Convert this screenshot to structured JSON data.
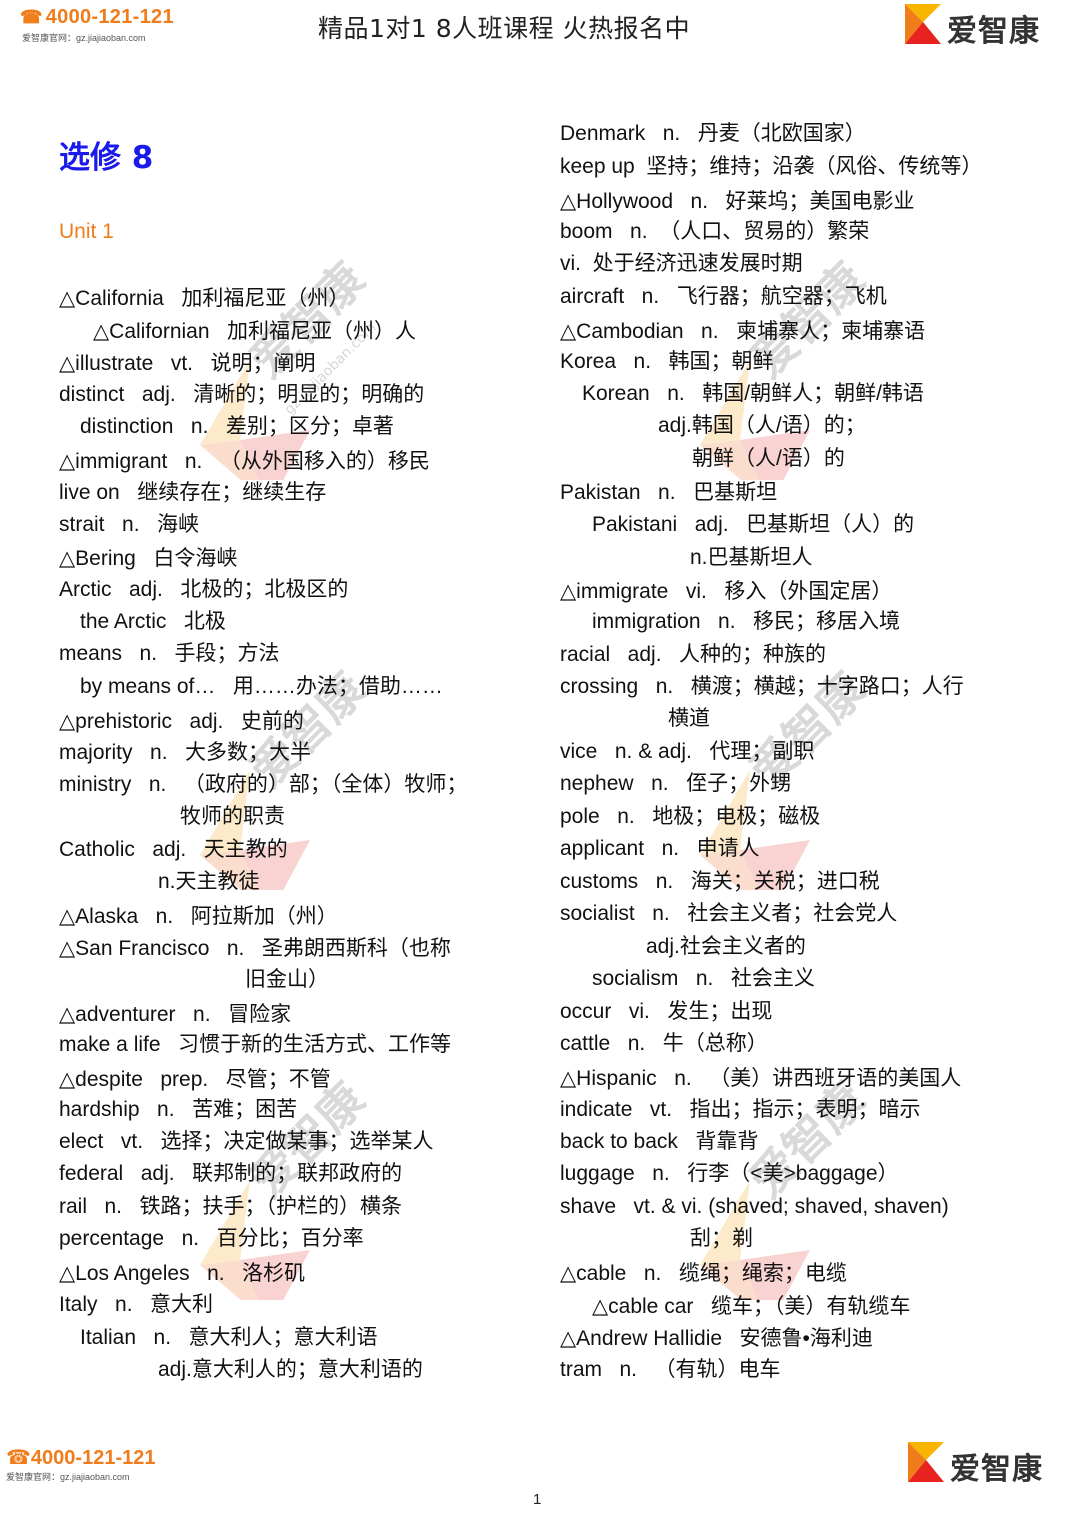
{
  "header": {
    "phone": "4000-121-121",
    "site": "爱智康官网：gz.jiajiaoban.com",
    "slogan": "精品1对1  8人班课程 火热报名中",
    "brand": "爱智康",
    "phone_icon": "phone-icon"
  },
  "document": {
    "title": "选修 8",
    "unit": "Unit 1"
  },
  "left_column": [
    "△California   加利福尼亚（州）",
    "△Californian   加利福尼亚（州）人",
    "△illustrate   vt.   说明；阐明",
    "distinct   adj.   清晰的；明显的；明确的",
    "distinction   n.   差别；区分；卓著",
    "△immigrant   n.   （从外国移入的）移民",
    "live on   继续存在；继续生存",
    "strait   n.   海峡",
    "△Bering   白令海峡",
    "Arctic   adj.   北极的；北极区的",
    "the Arctic   北极",
    "means   n.   手段；方法",
    "by means of…   用……办法；借助……",
    "△prehistoric   adj.   史前的",
    "majority   n.   大多数；大半",
    "ministry   n.   （政府的）部；（全体）牧师；",
    "牧师的职责",
    "Catholic   adj.   天主教的",
    "n.天主教徒",
    "△Alaska   n.   阿拉斯加（州）",
    "△San Francisco   n.   圣弗朗西斯科（也称",
    "旧金山）",
    "△adventurer   n.   冒险家",
    "make a life   习惯于新的生活方式、工作等",
    "△despite   prep.   尽管；不管",
    "hardship   n.   苦难；困苦",
    "elect   vt.   选择；决定做某事；选举某人",
    "federal   adj.   联邦制的；联邦政府的",
    "rail   n.   铁路；扶手；（护栏的）横条",
    "percentage   n.   百分比；百分率",
    "△Los Angeles   n.   洛杉矶",
    "Italy   n.   意大利",
    "Italian   n.   意大利人；意大利语",
    "adj.意大利人的；意大利语的"
  ],
  "right_column": [
    "Denmark   n.   丹麦（北欧国家）",
    "keep up  坚持；维持；沿袭（风俗、传统等）",
    "△Hollywood   n.   好莱坞；美国电影业",
    "boom   n.  （人口、贸易的）繁荣",
    "vi.  处于经济迅速发展时期",
    "aircraft   n.   飞行器；航空器；飞机",
    "△Cambodian   n.   柬埔寨人；柬埔寨语",
    "Korea   n.   韩国；朝鲜",
    "Korean   n.   韩国/朝鲜人；朝鲜/韩语",
    "adj.韩国（人/语）的；",
    "朝鲜（人/语）的",
    "Pakistan   n.   巴基斯坦",
    "Pakistani   adj.   巴基斯坦（人）的",
    "n.巴基斯坦人",
    "△immigrate   vi.   移入（外国定居）",
    "immigration   n.   移民；移居入境",
    "racial   adj.   人种的；种族的",
    "crossing   n.   横渡；横越；十字路口；人行",
    "横道",
    "vice   n. & adj.   代理；副职",
    "nephew   n.   侄子；外甥",
    "pole   n.   地极；电极；磁极",
    "applicant   n.   申请人",
    "customs   n.   海关；关税；进口税",
    "socialist   n.   社会主义者；社会党人",
    "adj.社会主义者的",
    "socialism   n.   社会主义",
    "occur   vi.   发生；出现",
    "cattle   n.   牛（总称）",
    "△Hispanic   n.   （美）讲西班牙语的美国人",
    "indicate   vt.   指出；指示；表明；暗示",
    "back to back   背靠背",
    "luggage   n.   行李（<美>baggage）",
    "shave   vt. & vi. (shaved; shaved, shaven)",
    "刮；剃",
    "△cable   n.   缆绳；绳索；电缆",
    "△cable car   缆车；（美）有轨缆车",
    "△Andrew Hallidie   安德鲁•海利迪",
    "tram   n.   （有轨）电车"
  ],
  "footer": {
    "phone": "4000-121-121",
    "site": "爱智康官网：gz.jiajiaoban.com",
    "brand": "爱智康",
    "page_number": "1"
  },
  "colors": {
    "brand_orange": "#f07c1a",
    "title_blue": "#1a1aeb",
    "logo_yellow": "#f7b500",
    "logo_orange": "#f07c1a",
    "logo_red": "#e8221e"
  }
}
